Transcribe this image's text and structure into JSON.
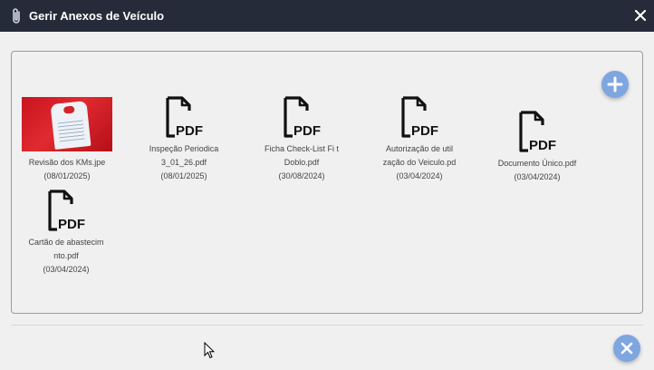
{
  "dialog": {
    "title": "Gerir Anexos de Veículo",
    "icons": {
      "title": "paperclip-icon",
      "close": "close-icon",
      "add": "plus-icon",
      "footer_close": "close-circle-icon"
    },
    "colors": {
      "titlebar": "#252b38",
      "accent": "#7ea6e0",
      "background": "#f0f0f0"
    }
  },
  "attachments": [
    {
      "type": "image",
      "name_line1": "Revisão dos KMs.jpe",
      "name_line2": "",
      "date": "(08/01/2025)"
    },
    {
      "type": "pdf",
      "name_line1": "Inspeção Periodica",
      "name_line2": "3_01_26.pdf",
      "date": "(08/01/2025)"
    },
    {
      "type": "pdf",
      "name_line1": "Ficha Check-List Fi t",
      "name_line2": "Doblo.pdf",
      "date": "(30/08/2024)"
    },
    {
      "type": "pdf",
      "name_line1": "Autorização de util",
      "name_line2": "zação do Veiculo.pd",
      "date": "(03/04/2024)"
    },
    {
      "type": "pdf",
      "name_line1": "Documento Único.pdf",
      "name_line2": "",
      "date": "(03/04/2024)"
    },
    {
      "type": "pdf",
      "name_line1": "Cartão de abastecim",
      "name_line2": "nto.pdf",
      "date": "(03/04/2024)"
    }
  ],
  "pdf_label": "PDF"
}
